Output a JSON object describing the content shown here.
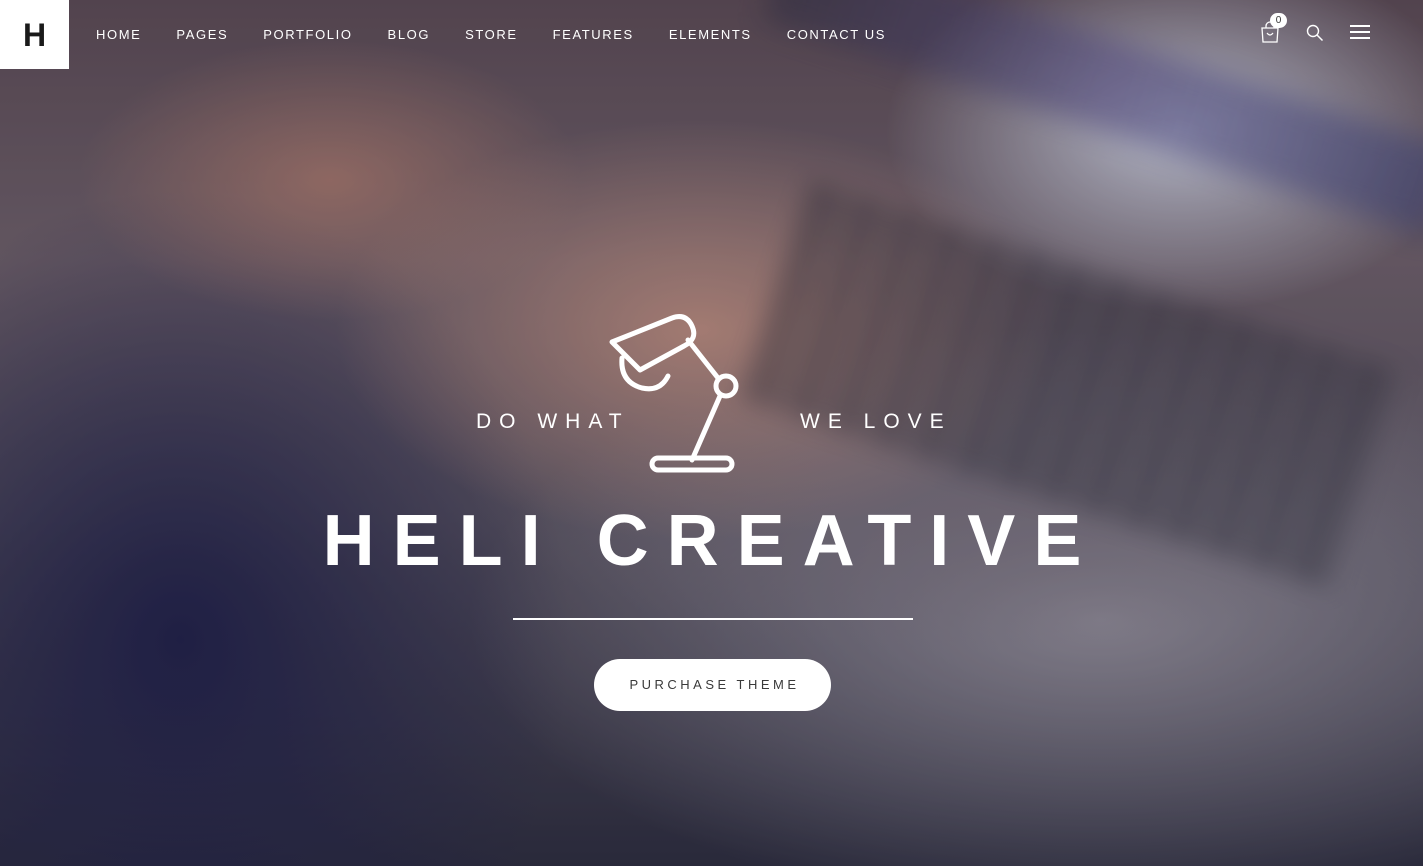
{
  "logo": {
    "letter": "H"
  },
  "nav": {
    "items": [
      {
        "label": "HOME"
      },
      {
        "label": "PAGES"
      },
      {
        "label": "PORTFOLIO"
      },
      {
        "label": "BLOG"
      },
      {
        "label": "STORE"
      },
      {
        "label": "FEATURES"
      },
      {
        "label": "ELEMENTS"
      },
      {
        "label": "CONTACT US"
      }
    ]
  },
  "tools": {
    "cart_icon": "shopping-bag-icon",
    "cart_count": "0",
    "search_icon": "search-icon",
    "menu_icon": "hamburger-menu-icon"
  },
  "hero": {
    "tagline_left": "DO WHAT",
    "tagline_right": "WE LOVE",
    "lamp_icon": "desk-lamp-icon",
    "title": "HELI CREATIVE",
    "cta_label": "PURCHASE THEME"
  },
  "colors": {
    "header_logo_bg": "#ffffff",
    "text": "#ffffff",
    "cta_bg": "#ffffff",
    "cta_text": "#3a3a3a"
  }
}
